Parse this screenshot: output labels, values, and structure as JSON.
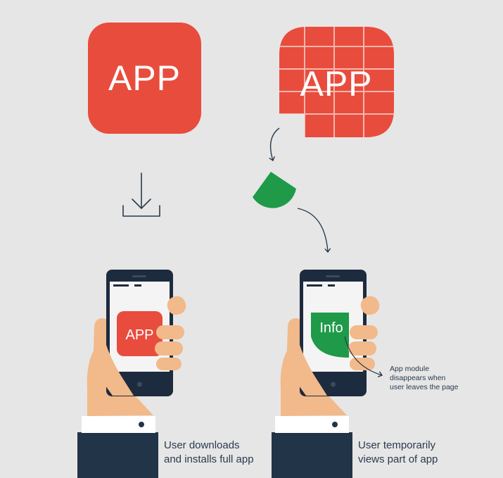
{
  "big_app_icon": {
    "label": "APP",
    "color": "#e84c3d"
  },
  "grid_app_icon": {
    "label": "APP",
    "color": "#e84c3d"
  },
  "phone_left": {
    "screen_label": "APP"
  },
  "phone_right": {
    "screen_label": "Info"
  },
  "module_note": {
    "line1": "App module",
    "line2": "disappears when",
    "line3": "user leaves the page"
  },
  "caption_left": {
    "line1": "User downloads",
    "line2": "and installs full app"
  },
  "caption_right": {
    "line1": "User temporarily",
    "line2": "views part of app"
  },
  "colors": {
    "background": "#e6e6e6",
    "red": "#e84c3d",
    "green": "#1f9a48",
    "navy": "#213448",
    "skin": "#f2b98a",
    "phone_body": "#1d2b3e",
    "screen": "#f4f4f4"
  },
  "icons": [
    "download-icon",
    "curved-arrow-icon",
    "green-module-icon",
    "smartphone-icon",
    "hand-icon"
  ]
}
